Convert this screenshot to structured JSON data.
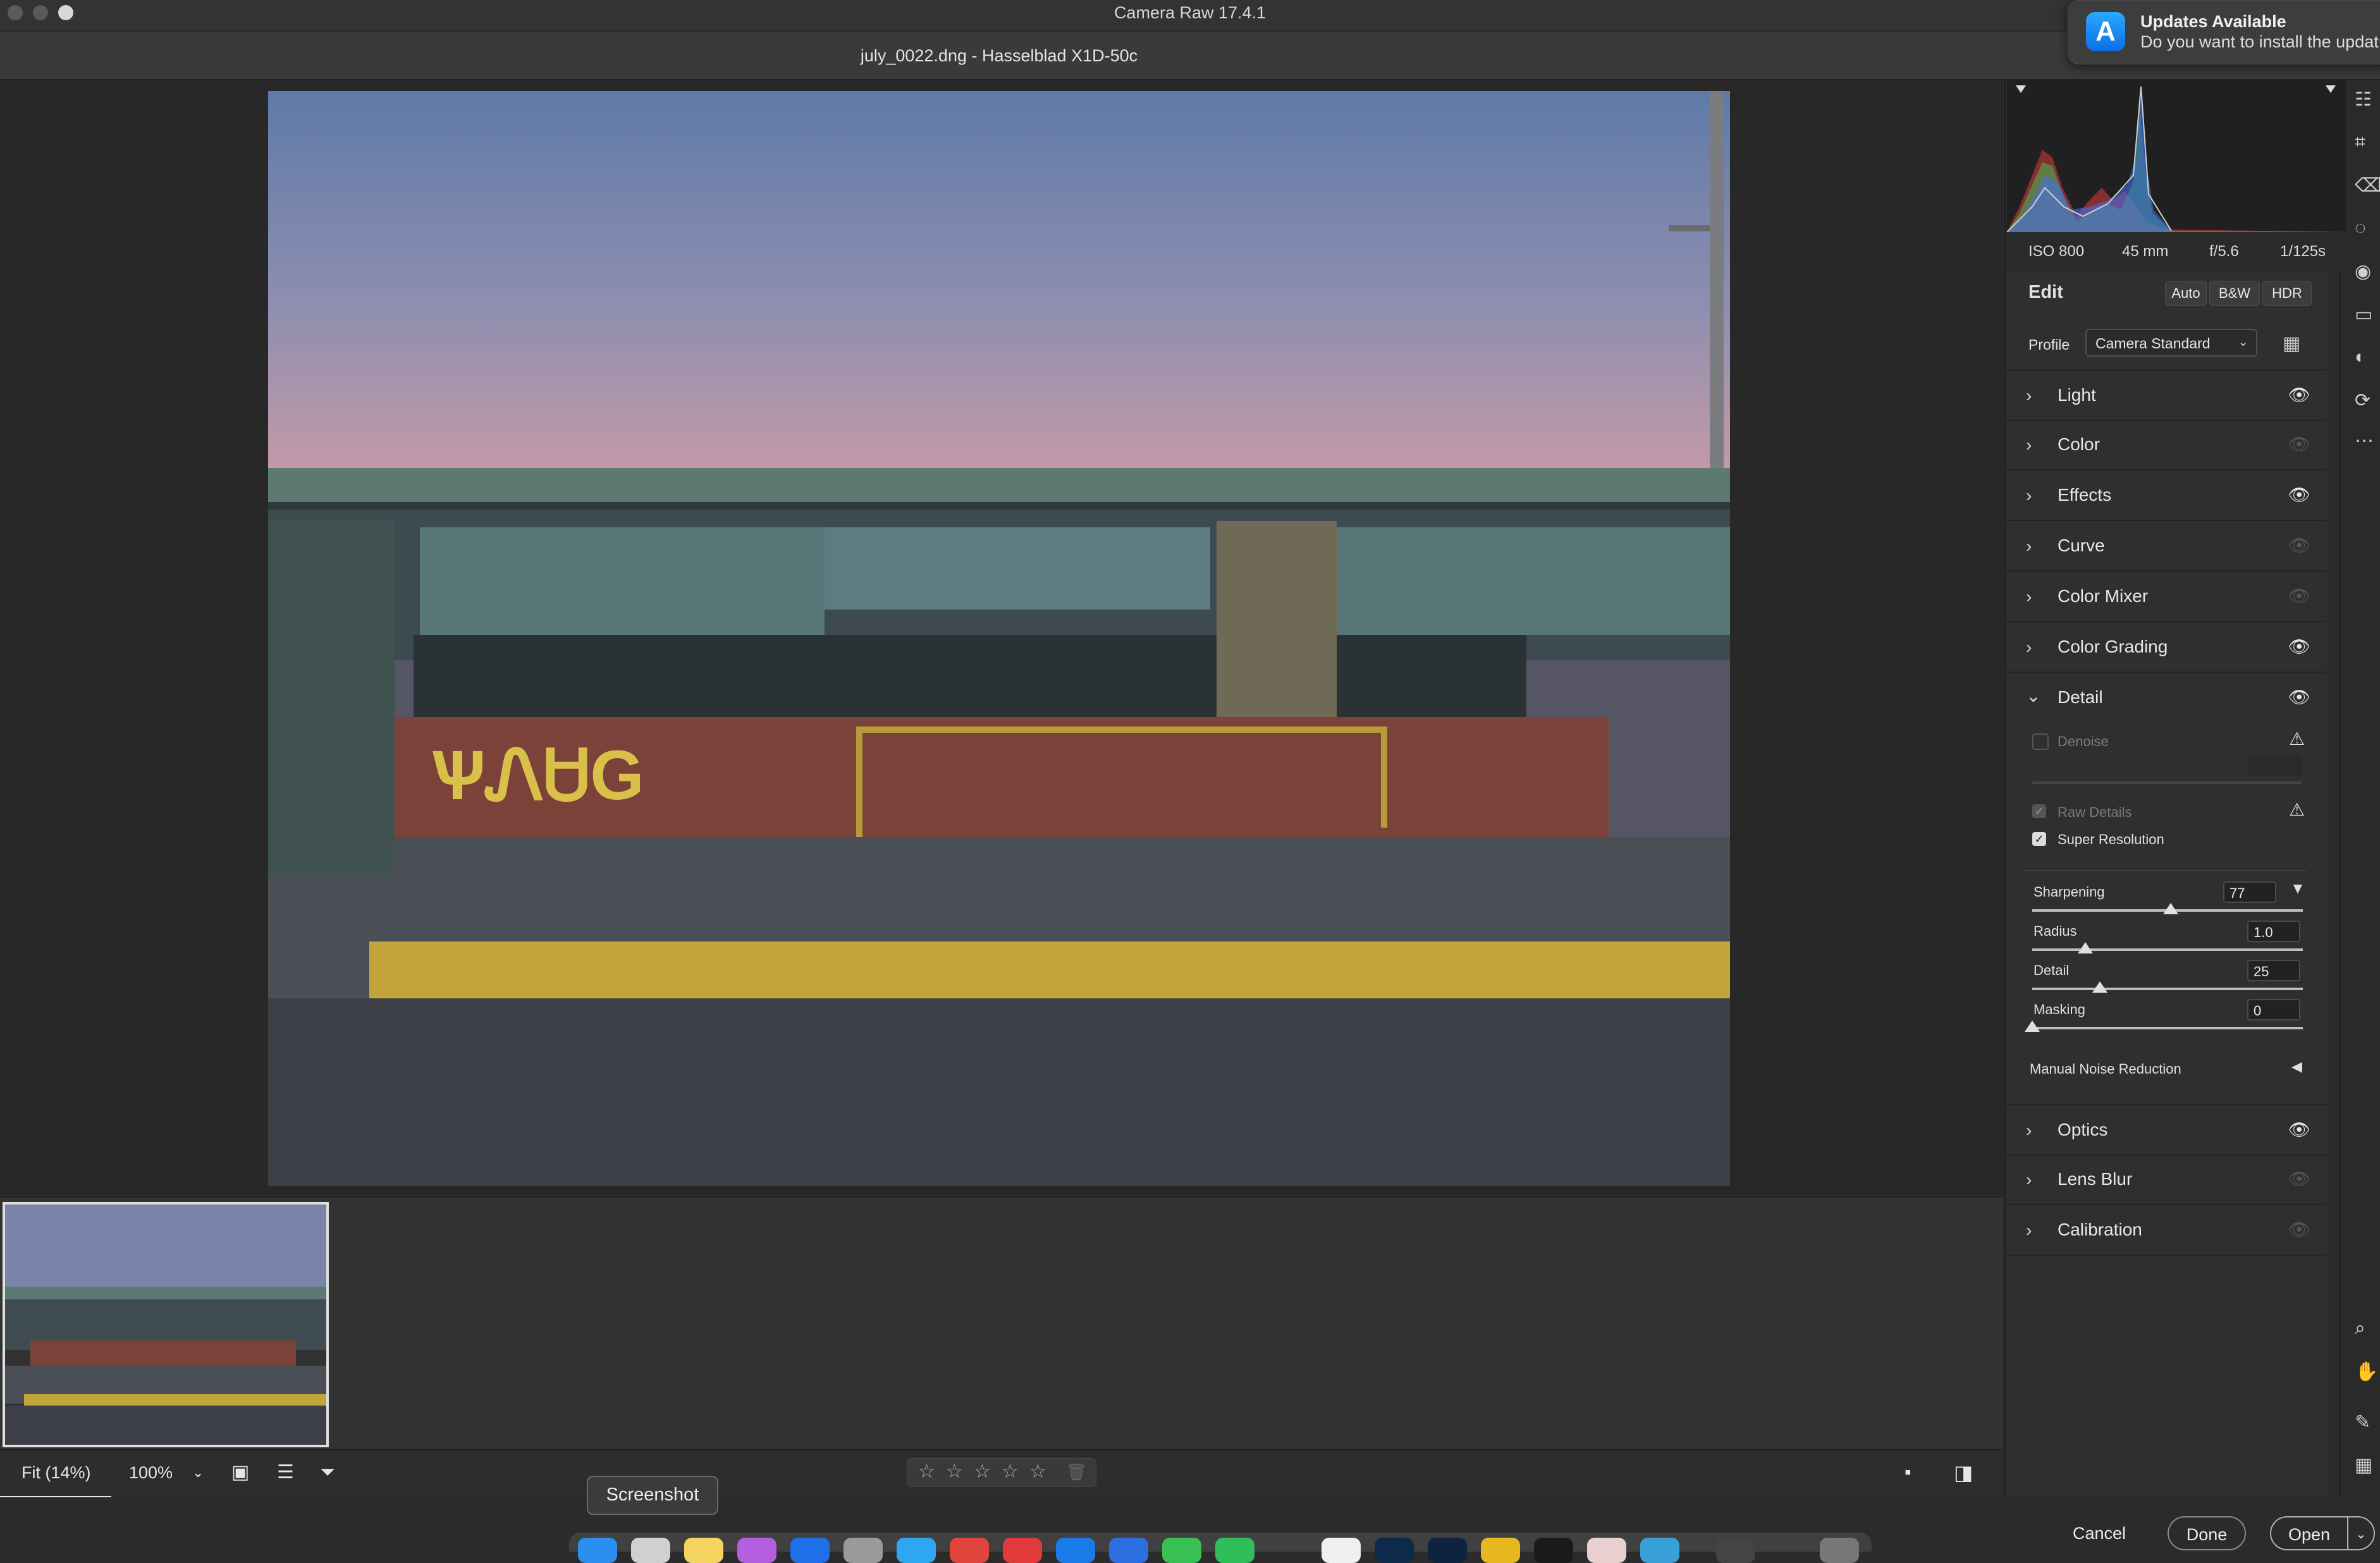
{
  "window": {
    "app_title": "Camera Raw 17.4.1",
    "file_title": "july_0022.dng  -  Hasselblad X1D-50c"
  },
  "notification": {
    "title": "Updates Available",
    "body": "Do you want to install the updat"
  },
  "histogram": {
    "iso": "ISO 800",
    "focal": "45 mm",
    "aperture": "f/5.6",
    "shutter": "1/125s"
  },
  "edit": {
    "title": "Edit",
    "buttons": [
      "Auto",
      "B&W",
      "HDR"
    ],
    "profile_label": "Profile",
    "profile_value": "Camera Standard"
  },
  "sections": [
    {
      "label": "Light",
      "expanded": false,
      "visible": true
    },
    {
      "label": "Color",
      "expanded": false,
      "visible": false
    },
    {
      "label": "Effects",
      "expanded": false,
      "visible": true
    },
    {
      "label": "Curve",
      "expanded": false,
      "visible": false
    },
    {
      "label": "Color Mixer",
      "expanded": false,
      "visible": false
    },
    {
      "label": "Color Grading",
      "expanded": false,
      "visible": true
    },
    {
      "label": "Detail",
      "expanded": true,
      "visible": true
    },
    {
      "label": "Optics",
      "expanded": false,
      "visible": true
    },
    {
      "label": "Lens Blur",
      "expanded": false,
      "visible": false
    },
    {
      "label": "Calibration",
      "expanded": false,
      "visible": false
    }
  ],
  "detail": {
    "denoise_label": "Denoise",
    "raw_details_label": "Raw Details",
    "super_resolution_label": "Super Resolution",
    "super_resolution_checked": true,
    "sliders": [
      {
        "label": "Sharpening",
        "value": "77",
        "fraction": 0.51
      },
      {
        "label": "Radius",
        "value": "1.0",
        "fraction": 0.19
      },
      {
        "label": "Detail",
        "value": "25",
        "fraction": 0.25
      },
      {
        "label": "Masking",
        "value": "0",
        "fraction": 0.0
      }
    ],
    "manual_noise_label": "Manual Noise Reduction"
  },
  "bottombar": {
    "fit_label": "Fit (14%)",
    "zoom_label": "100%"
  },
  "footer": {
    "cancel": "Cancel",
    "done": "Done",
    "open": "Open"
  },
  "tooltip": "Screenshot",
  "colors": {
    "accent": "#1473e6",
    "panel": "#2f2f2f",
    "background": "#2b2b2b"
  }
}
